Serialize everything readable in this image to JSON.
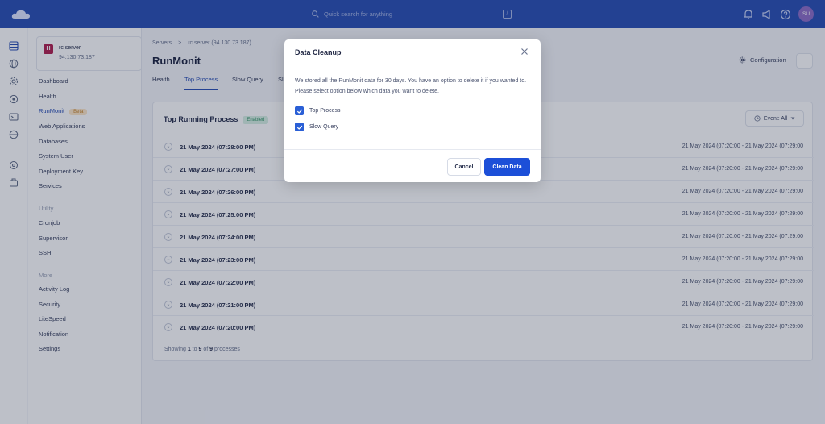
{
  "search": {
    "placeholder": "Quick search for anything",
    "shortcut": "/"
  },
  "user": {
    "initials": "SU"
  },
  "server": {
    "badge": "H",
    "name": "rc server",
    "ip": "94.130.73.187"
  },
  "sidebar": {
    "items": [
      {
        "label": "Dashboard"
      },
      {
        "label": "Health"
      },
      {
        "label": "RunMonit",
        "badge": "Beta"
      },
      {
        "label": "Web Applications"
      },
      {
        "label": "Databases"
      },
      {
        "label": "System User"
      },
      {
        "label": "Deployment Key"
      },
      {
        "label": "Services"
      }
    ],
    "utility_title": "Utility",
    "utility": [
      {
        "label": "Cronjob"
      },
      {
        "label": "Supervisor"
      },
      {
        "label": "SSH"
      }
    ],
    "more_title": "More",
    "more": [
      {
        "label": "Activity Log"
      },
      {
        "label": "Security"
      },
      {
        "label": "LiteSpeed"
      },
      {
        "label": "Notification"
      },
      {
        "label": "Settings"
      }
    ]
  },
  "breadcrumb": {
    "root": "Servers",
    "sep": ">",
    "current": "rc server (94.130.73.187)"
  },
  "page": {
    "title": "RunMonit",
    "configuration": "Configuration",
    "more": "⋯"
  },
  "tabs": [
    {
      "label": "Health"
    },
    {
      "label": "Top Process"
    },
    {
      "label": "Slow Query"
    },
    {
      "label": "Sl"
    }
  ],
  "panel": {
    "title": "Top Running Process",
    "status": "Enabled",
    "event_filter": "Event: All",
    "rows": [
      {
        "label": "21 May 2024 (07:28:00 PM)",
        "range": "21 May 2024 (07:20:00 - 21 May 2024 (07:29:00"
      },
      {
        "label": "21 May 2024 (07:27:00 PM)",
        "range": "21 May 2024 (07:20:00 - 21 May 2024 (07:29:00"
      },
      {
        "label": "21 May 2024 (07:26:00 PM)",
        "range": "21 May 2024 (07:20:00 - 21 May 2024 (07:29:00"
      },
      {
        "label": "21 May 2024 (07:25:00 PM)",
        "range": "21 May 2024 (07:20:00 - 21 May 2024 (07:29:00"
      },
      {
        "label": "21 May 2024 (07:24:00 PM)",
        "range": "21 May 2024 (07:20:00 - 21 May 2024 (07:29:00"
      },
      {
        "label": "21 May 2024 (07:23:00 PM)",
        "range": "21 May 2024 (07:20:00 - 21 May 2024 (07:29:00"
      },
      {
        "label": "21 May 2024 (07:22:00 PM)",
        "range": "21 May 2024 (07:20:00 - 21 May 2024 (07:29:00"
      },
      {
        "label": "21 May 2024 (07:21:00 PM)",
        "range": "21 May 2024 (07:20:00 - 21 May 2024 (07:29:00"
      },
      {
        "label": "21 May 2024 (07:20:00 PM)",
        "range": "21 May 2024 (07:20:00 - 21 May 2024 (07:29:00"
      }
    ],
    "footer": {
      "prefix": "Showing",
      "from": "1",
      "to_word": "to",
      "to": "9",
      "of_word": "of",
      "total": "9",
      "suffix": "processes"
    }
  },
  "modal": {
    "title": "Data Cleanup",
    "description": "We stored all the RunMonit data for 30 days. You have an option to delete it if you wanted to. Please select option below which data you want to delete.",
    "options": [
      {
        "label": "Top Process",
        "checked": true
      },
      {
        "label": "Slow Query",
        "checked": true
      }
    ],
    "cancel_label": "Cancel",
    "confirm_label": "Clean Data"
  },
  "colors": {
    "topbar": "#2a4fb5",
    "primary_button": "#1c4fd8",
    "checkbox": "#2a5fd6",
    "active_link": "#2a4fb5"
  }
}
